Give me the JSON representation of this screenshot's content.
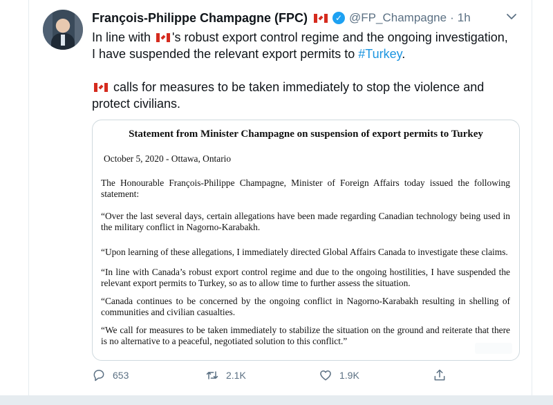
{
  "author": {
    "name": "François-Philippe Champagne (FPC)",
    "handle": "@FP_Champagne",
    "separator": "·",
    "time": "1h"
  },
  "tweet": {
    "line1_pre": "In line with ",
    "line1_post": "'s robust export control regime and the ongoing investigation,",
    "line2_pre": "I have suspended the relevant export permits to ",
    "hashtag": "#Turkey",
    "line2_post": ".",
    "line3_post": " calls for measures to be taken immediately to stop the violence and",
    "line4": "protect civilians."
  },
  "statement": {
    "title": "Statement from Minister Champagne on suspension of export permits to Turkey",
    "date": "October 5, 2020 - Ottawa, Ontario",
    "p1": "The Honourable François-Philippe Champagne, Minister of Foreign Affairs today issued the following statement:",
    "p2": "“Over the last several days, certain allegations have been made regarding Canadian technology being used in the military conflict in Nagorno-Karabakh.",
    "p3": "“Upon learning of these allegations, I immediately directed Global Affairs Canada to investigate these claims.",
    "p4": "“In line with Canada’s robust export control regime and due to the ongoing hostilities, I have suspended the relevant export permits to Turkey, so as to allow time to further assess the situation.",
    "p5": "“Canada continues to be concerned by the ongoing conflict in Nagorno-Karabakh resulting in shelling of communities and civilian casualties.",
    "p6": "“We call for measures to be taken immediately to stabilize the situation on the ground and reiterate that there is no alternative to a peaceful, negotiated solution to this conflict.”"
  },
  "actions": {
    "replies": "653",
    "retweets": "2.1K",
    "likes": "1.9K"
  },
  "colors": {
    "link": "#1b95e0",
    "secondary": "#5b7083",
    "verified": "#1da1f2"
  },
  "icons": [
    "canada-flag-icon",
    "verified-badge-icon",
    "chevron-down-icon",
    "reply-icon",
    "retweet-icon",
    "like-icon",
    "share-icon"
  ]
}
